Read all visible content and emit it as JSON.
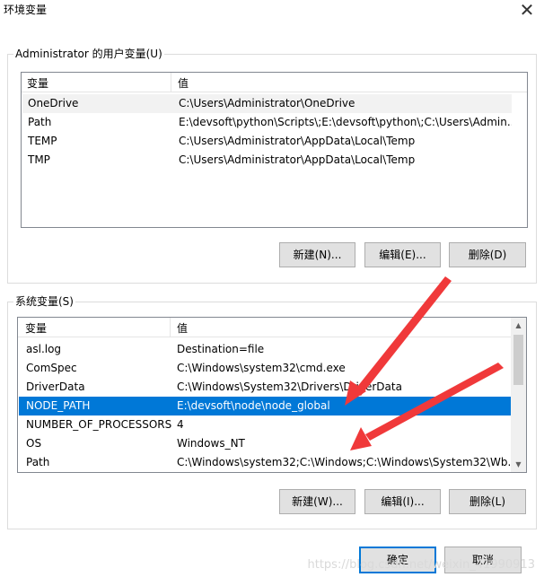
{
  "window": {
    "title": "环境变量"
  },
  "user_vars": {
    "group_label": "Administrator 的用户变量(U)",
    "columns": [
      "变量",
      "值"
    ],
    "rows": [
      {
        "name": "OneDrive",
        "value": "C:\\Users\\Administrator\\OneDrive"
      },
      {
        "name": "Path",
        "value": "E:\\devsoft\\python\\Scripts\\;E:\\devsoft\\python\\;C:\\Users\\Admin..."
      },
      {
        "name": "TEMP",
        "value": "C:\\Users\\Administrator\\AppData\\Local\\Temp"
      },
      {
        "name": "TMP",
        "value": "C:\\Users\\Administrator\\AppData\\Local\\Temp"
      }
    ],
    "buttons": {
      "new": "新建(N)...",
      "edit": "编辑(E)...",
      "delete": "删除(D)"
    }
  },
  "system_vars": {
    "group_label": "系统变量(S)",
    "columns": [
      "变量",
      "值"
    ],
    "rows": [
      {
        "name": "asl.log",
        "value": "Destination=file"
      },
      {
        "name": "ComSpec",
        "value": "C:\\Windows\\system32\\cmd.exe"
      },
      {
        "name": "DriverData",
        "value": "C:\\Windows\\System32\\Drivers\\DriverData"
      },
      {
        "name": "NODE_PATH",
        "value": "E:\\devsoft\\node\\node_global"
      },
      {
        "name": "NUMBER_OF_PROCESSORS",
        "value": "4"
      },
      {
        "name": "OS",
        "value": "Windows_NT"
      },
      {
        "name": "Path",
        "value": "C:\\Windows\\system32;C:\\Windows;C:\\Windows\\System32\\Wb..."
      }
    ],
    "selected_index": 3,
    "buttons": {
      "new": "新建(W)...",
      "edit": "编辑(I)...",
      "delete": "删除(L)"
    }
  },
  "footer": {
    "ok": "确定",
    "cancel": "取消"
  },
  "watermark": "https://blog.csdn.net/weixin_41990913",
  "colors": {
    "selection": "#0078d7",
    "arrow": "#f0393a"
  }
}
